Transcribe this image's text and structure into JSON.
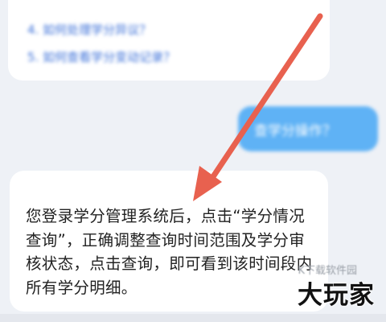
{
  "chat": {
    "top_card": {
      "questions": [
        "4. 如何处理学分异议？",
        "5. 如何查看学分变动记录？"
      ]
    },
    "user_message": "查学分操作？",
    "answer": "您登录学分管理系统后，点击“学分情况查询”，正确调整查询时间范围及学分审核状态，点击查询，即可看到该时间段内所有学分明细。"
  },
  "annotation": {
    "arrow_color": "#e8614f"
  },
  "watermark": {
    "brand": "大玩家",
    "small_text": "K下载软件园"
  }
}
